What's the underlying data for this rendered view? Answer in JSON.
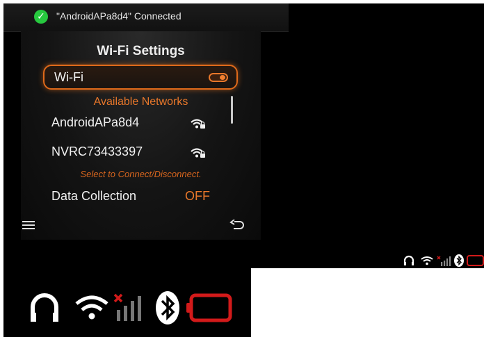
{
  "notification": {
    "text": "\"AndroidAPa8d4\" Connected",
    "icon": "check-circle-icon",
    "icon_glyph": "✓"
  },
  "screen": {
    "title": "Wi-Fi Settings",
    "wifi_toggle": {
      "label": "Wi-Fi",
      "state": "on"
    },
    "available_header": "Available Networks",
    "networks": [
      {
        "name": "AndroidAPa8d4",
        "icon": "wifi-lock-icon"
      },
      {
        "name": "NVRC73433397",
        "icon": "wifi-lock-icon"
      }
    ],
    "hint": "Select to Connect/Disconnect.",
    "data_collection": {
      "label": "Data Collection",
      "value": "OFF"
    }
  },
  "navigation": {
    "menu_icon": "menu-icon",
    "back_icon": "back-icon"
  },
  "status_bar": {
    "icons": [
      "headphones-icon",
      "wifi-icon",
      "cellular-no-signal-icon",
      "bluetooth-icon",
      "battery-empty-icon"
    ]
  },
  "colors": {
    "accent": "#e8772a",
    "success": "#27c93f",
    "battery_alert": "#d21a1a",
    "background": "#000000"
  }
}
